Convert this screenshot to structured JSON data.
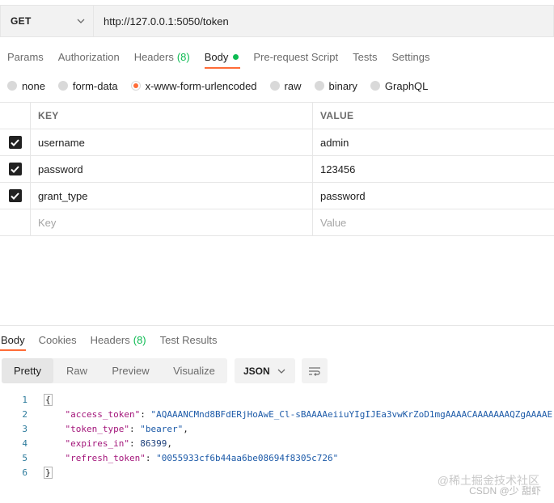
{
  "request": {
    "method": "GET",
    "url": "http://127.0.0.1:5050/token"
  },
  "request_tabs": [
    {
      "label": "Params",
      "count": ""
    },
    {
      "label": "Authorization",
      "count": ""
    },
    {
      "label": "Headers",
      "count": "(8)"
    },
    {
      "label": "Body",
      "count": ""
    },
    {
      "label": "Pre-request Script",
      "count": ""
    },
    {
      "label": "Tests",
      "count": ""
    },
    {
      "label": "Settings",
      "count": ""
    }
  ],
  "body_types": [
    {
      "label": "none"
    },
    {
      "label": "form-data"
    },
    {
      "label": "x-www-form-urlencoded"
    },
    {
      "label": "raw"
    },
    {
      "label": "binary"
    },
    {
      "label": "GraphQL"
    }
  ],
  "kv_table": {
    "key_header": "KEY",
    "value_header": "VALUE",
    "rows": [
      {
        "key": "username",
        "value": "admin",
        "checked": true
      },
      {
        "key": "password",
        "value": "123456",
        "checked": true
      },
      {
        "key": "grant_type",
        "value": "password",
        "checked": true
      }
    ],
    "key_placeholder": "Key",
    "value_placeholder": "Value"
  },
  "response_tabs": [
    {
      "label": "Body",
      "count": ""
    },
    {
      "label": "Cookies",
      "count": ""
    },
    {
      "label": "Headers",
      "count": "(8)"
    },
    {
      "label": "Test Results",
      "count": ""
    }
  ],
  "view_modes": [
    "Pretty",
    "Raw",
    "Preview",
    "Visualize"
  ],
  "format": "JSON",
  "code": {
    "line_numbers": [
      "1",
      "2",
      "3",
      "4",
      "5",
      "6"
    ],
    "open_brace": "{",
    "close_brace": "}",
    "fields": [
      {
        "key": "\"access_token\"",
        "value": "\"AQAAANCMnd8BFdERjHoAwE_Cl-sBAAAAeiiuYIgIJEa3vwKrZoD1mgAAAACAAAAAAAQZgAAAAE",
        "type": "str",
        "comma": ""
      },
      {
        "key": "\"token_type\"",
        "value": "\"bearer\"",
        "type": "str",
        "comma": ","
      },
      {
        "key": "\"expires_in\"",
        "value": "86399",
        "type": "num",
        "comma": ","
      },
      {
        "key": "\"refresh_token\"",
        "value": "\"0055933cf6b44aa6be08694f8305c726\"",
        "type": "str",
        "comma": ""
      }
    ]
  },
  "watermark": {
    "line1": "@稀土掘金技术社区",
    "line2": "CSDN @少 甜虾"
  },
  "colors": {
    "accent": "#ff6c37",
    "count_green": "#0cbb52"
  }
}
